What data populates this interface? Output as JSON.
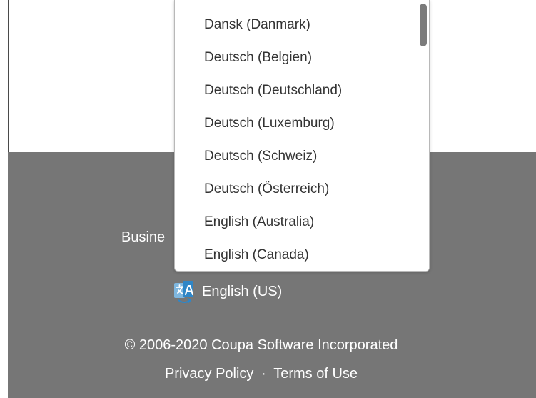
{
  "footer": {
    "business_link_label": "Busine",
    "language": {
      "icon": "translate-icon",
      "current_label": "English (US)",
      "options": [
        "Dansk (Danmark)",
        "Deutsch (Belgien)",
        "Deutsch (Deutschland)",
        "Deutsch (Luxemburg)",
        "Deutsch (Schweiz)",
        "Deutsch (Österreich)",
        "English (Australia)",
        "English (Canada)"
      ]
    },
    "copyright": "© 2006-2020 Coupa Software Incorporated",
    "privacy_policy": "Privacy Policy",
    "separator": "·",
    "terms_of_use": "Terms of Use"
  },
  "colors": {
    "footer_bg": "#767676",
    "footer_text": "#ffffff",
    "dropdown_bg": "#ffffff",
    "dropdown_text": "#333333",
    "icon_blue": "#2e86c1"
  }
}
